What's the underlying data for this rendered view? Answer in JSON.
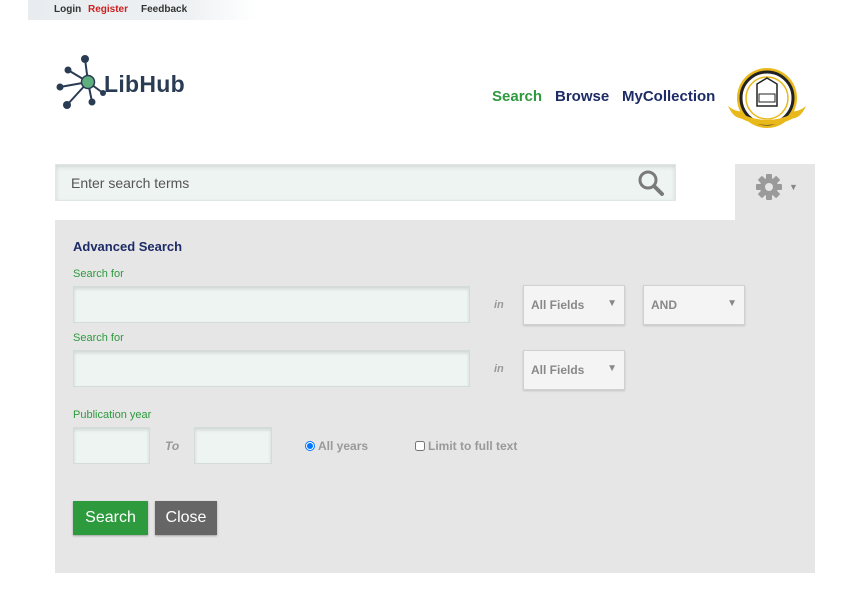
{
  "topbar": {
    "login": "Login",
    "register": "Register",
    "feedback": "Feedback"
  },
  "logo": {
    "text": "LibHub"
  },
  "nav": {
    "search": "Search",
    "browse": "Browse",
    "mycollection": "MyCollection"
  },
  "search": {
    "placeholder": "Enter search terms"
  },
  "advanced": {
    "title": "Advanced Search",
    "rows": [
      {
        "label": "Search for",
        "in": "in",
        "field": "All Fields",
        "operator": "AND"
      },
      {
        "label": "Search for",
        "in": "in",
        "field": "All Fields"
      }
    ],
    "pub_year": {
      "label": "Publication year",
      "to": "To"
    },
    "options": {
      "all_years": "All years",
      "full_text": "Limit to full text"
    },
    "buttons": {
      "search": "Search",
      "close": "Close"
    }
  },
  "colors": {
    "accent_green": "#2e9a3e",
    "nav_navy": "#1d2b66",
    "panel_bg": "#e6e6e6",
    "register_red": "#cc1f1f"
  }
}
